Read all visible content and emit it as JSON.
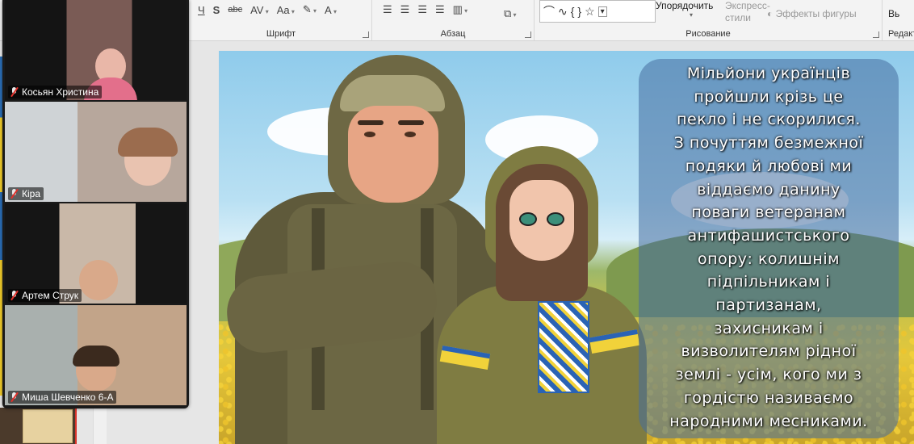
{
  "ribbon": {
    "groups": [
      {
        "label": "Шрифт"
      },
      {
        "label": "Абзац"
      },
      {
        "label": "Рисование"
      },
      {
        "label": "Редакт"
      }
    ],
    "font_tools": [
      "Ч",
      "S",
      "abc",
      "AV",
      "Aa",
      "A"
    ],
    "arrange_label": "Упорядочить",
    "quick_styles_label": "Экспресс-стили",
    "shape_effects_label": "Эффекты фигуры",
    "select_label": "Вь"
  },
  "participants": [
    {
      "name": "Косьян Христина",
      "muted": true
    },
    {
      "name": "Кіра",
      "muted": true
    },
    {
      "name": "Артем Струк",
      "muted": true
    },
    {
      "name": "Миша Шевченко 6-А",
      "muted": true
    }
  ],
  "slide": {
    "text": "Мільйони українців пройшли крізь це пекло і не скорилися. З почуттям безмежної подяки й любові ми віддаємо данину поваги ветеранам антифашистського опору: колишнім підпільникам і партизанам, захисникам і визволителям рідної землі - усім, кого ми з гордістю називаємо народними месниками.",
    "lines": [
      "Мільйони українців",
      "пройшли крізь це",
      "пекло і не скорилися.",
      "З почуттям безмежної",
      "подяки й любові ми",
      "віддаємо данину",
      "поваги ветеранам",
      "антифашистського",
      "опору: колишнім",
      "підпільникам і",
      "партизанам,",
      "захисникам і",
      "визволителям рідної",
      "землі - усім, кого ми з",
      "гордістю називаємо",
      "народними месниками."
    ]
  },
  "colors": {
    "accent_red": "#d9342b",
    "ribbon_bg": "#f3f3f3",
    "video_bg": "#1a1a1a"
  }
}
